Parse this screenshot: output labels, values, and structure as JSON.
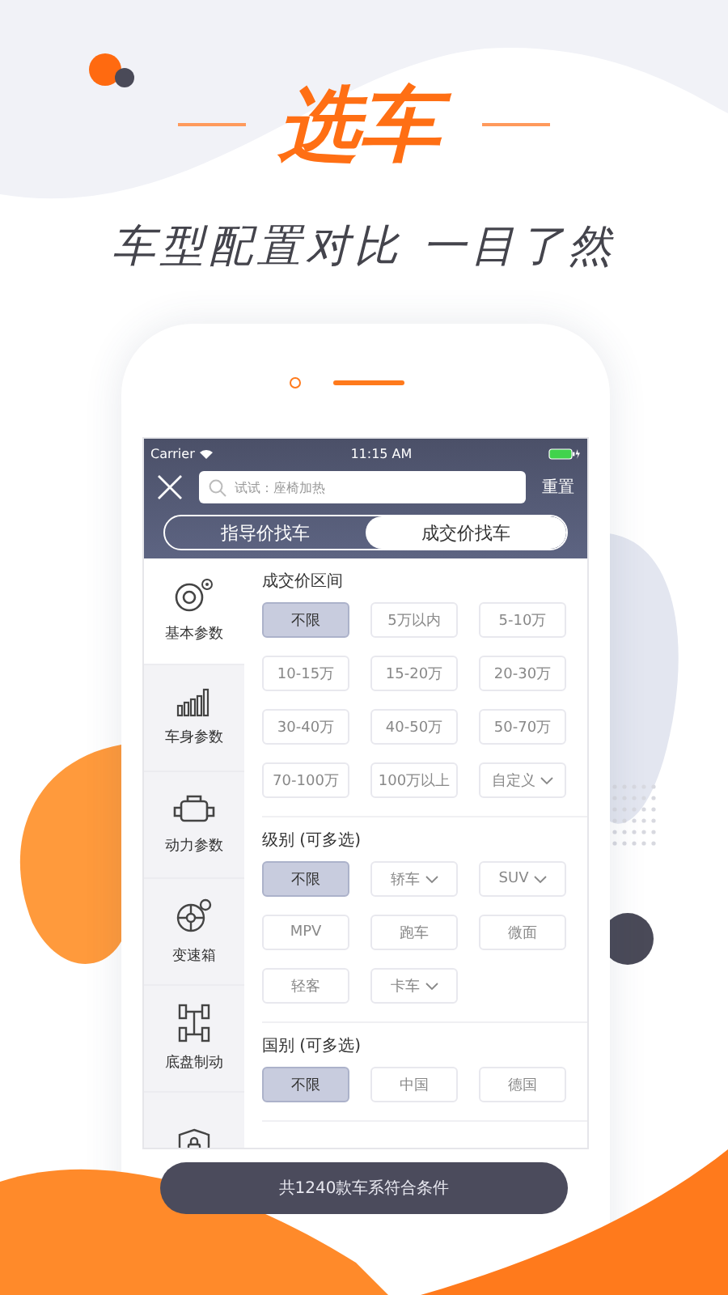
{
  "promo": {
    "title": "选车",
    "subtitle": "车型配置对比 一目了然"
  },
  "status_bar": {
    "carrier": "Carrier",
    "time": "11:15 AM"
  },
  "search": {
    "placeholder": "试试：座椅加热",
    "reset": "重置"
  },
  "tabs": [
    {
      "label": "指导价找车",
      "selected": false
    },
    {
      "label": "成交价找车",
      "selected": true
    }
  ],
  "sidebar": [
    {
      "label": "基本参数",
      "selected": true
    },
    {
      "label": "车身参数",
      "selected": false
    },
    {
      "label": "动力参数",
      "selected": false
    },
    {
      "label": "变速箱",
      "selected": false
    },
    {
      "label": "底盘制动",
      "selected": false
    },
    {
      "selected": false
    }
  ],
  "sections": [
    {
      "title": "成交价区间",
      "options": [
        {
          "label": "不限",
          "selected": true
        },
        {
          "label": "5万以内",
          "selected": false
        },
        {
          "label": "5-10万",
          "selected": false
        },
        {
          "label": "10-15万",
          "selected": false
        },
        {
          "label": "15-20万",
          "selected": false
        },
        {
          "label": "20-30万",
          "selected": false
        },
        {
          "label": "30-40万",
          "selected": false
        },
        {
          "label": "40-50万",
          "selected": false
        },
        {
          "label": "50-70万",
          "selected": false
        },
        {
          "label": "70-100万",
          "selected": false
        },
        {
          "label": "100万以上",
          "selected": false
        },
        {
          "label": "自定义",
          "selected": false,
          "dropdown": true
        }
      ]
    },
    {
      "title": "级别 (可多选)",
      "options": [
        {
          "label": "不限",
          "selected": true
        },
        {
          "label": "轿车",
          "selected": false,
          "dropdown": true
        },
        {
          "label": "SUV",
          "selected": false,
          "dropdown": true
        },
        {
          "label": "MPV",
          "selected": false
        },
        {
          "label": "跑车",
          "selected": false
        },
        {
          "label": "微面",
          "selected": false
        },
        {
          "label": "轻客",
          "selected": false
        },
        {
          "label": "卡车",
          "selected": false,
          "dropdown": true
        }
      ]
    },
    {
      "title": "国别 (可多选)",
      "options": [
        {
          "label": "不限",
          "selected": true
        },
        {
          "label": "中国",
          "selected": false
        },
        {
          "label": "德国",
          "selected": false
        }
      ]
    }
  ],
  "result_button": "共1240款车系符合条件"
}
